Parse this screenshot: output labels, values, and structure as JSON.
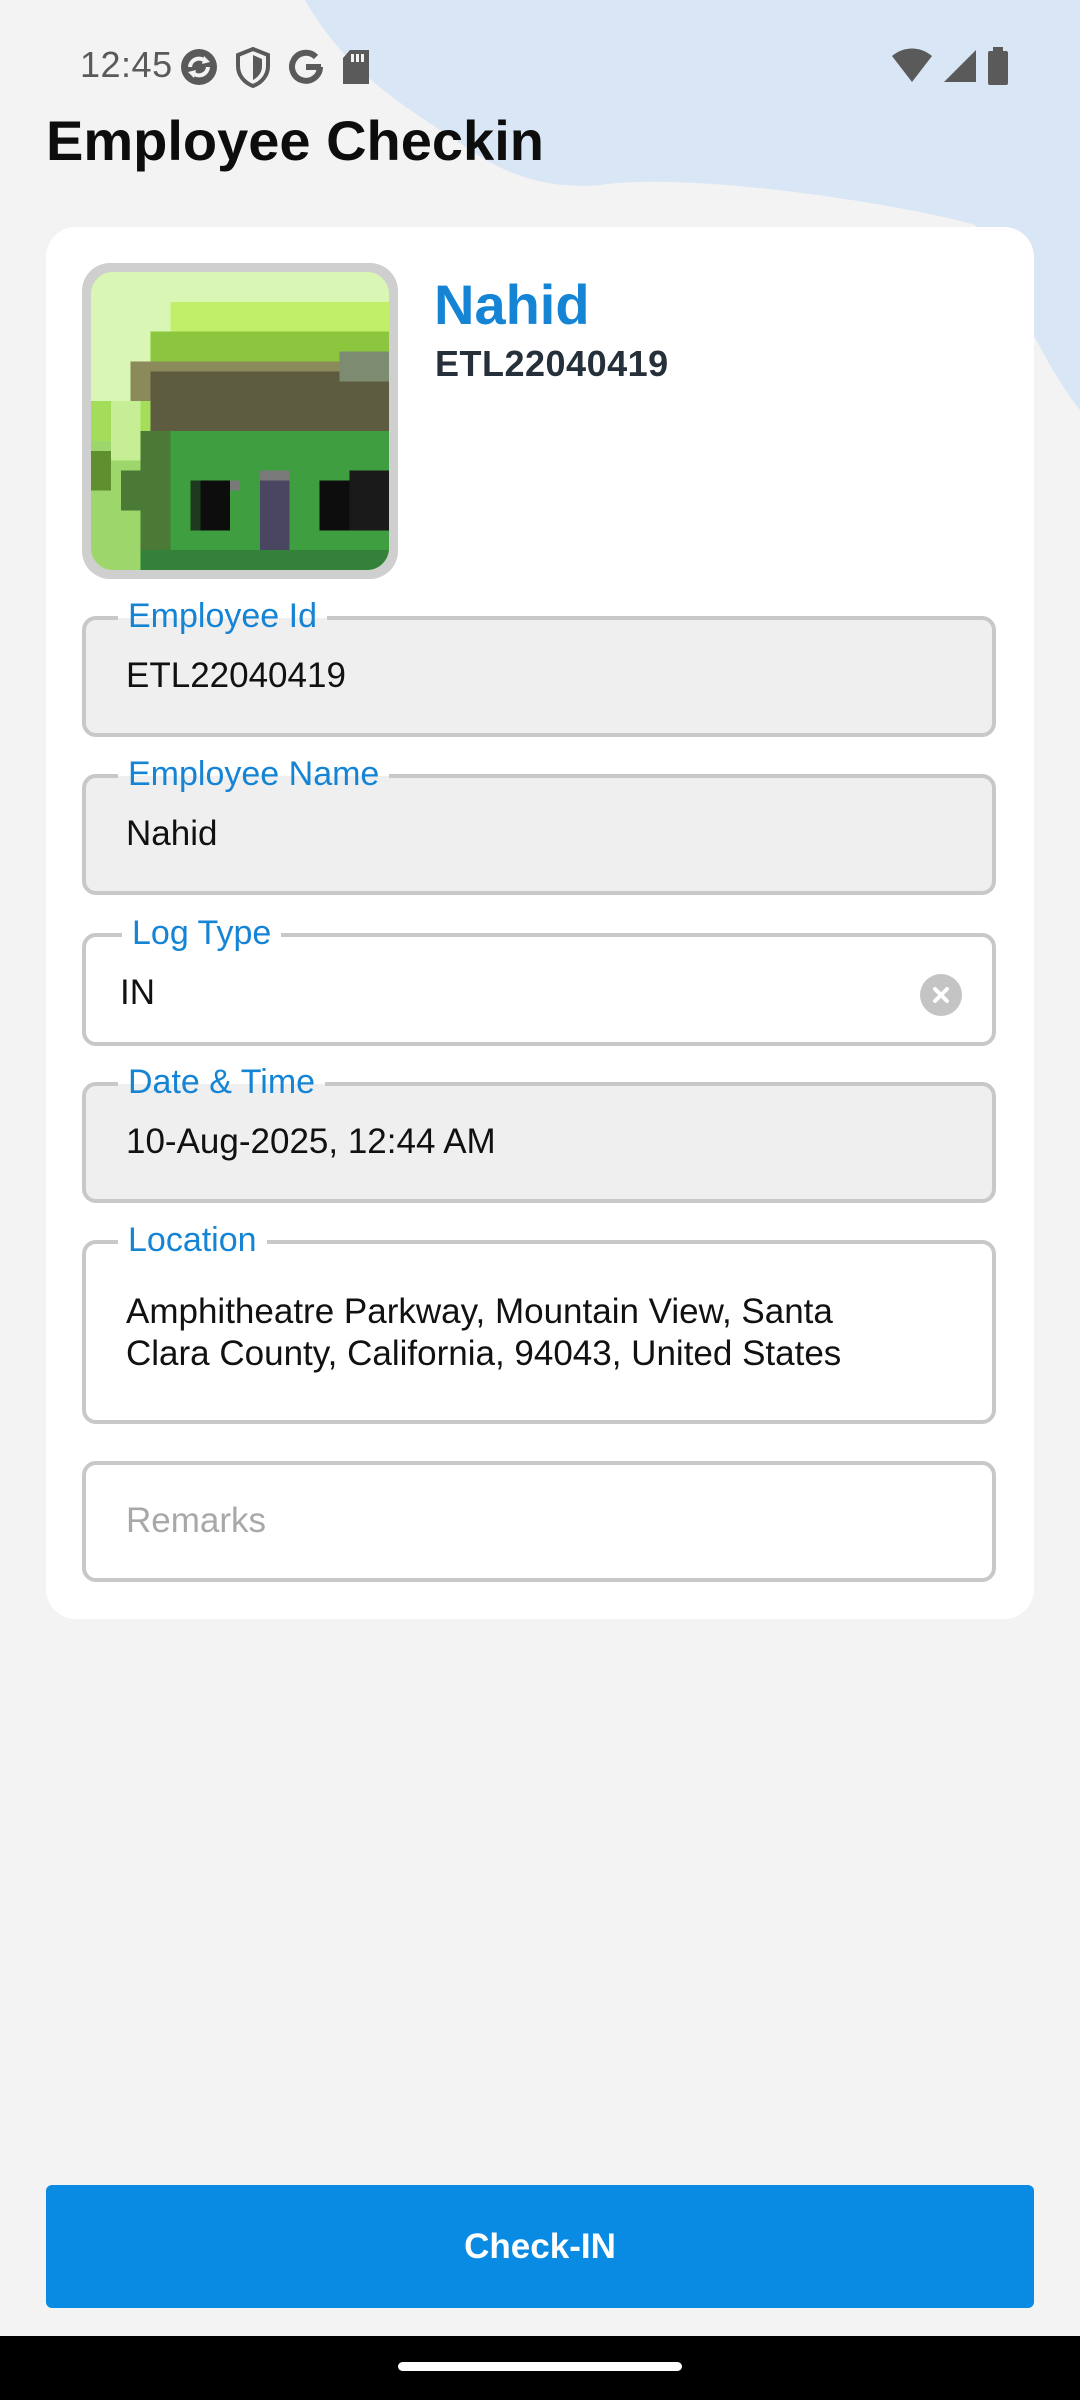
{
  "status_bar": {
    "time": "12:45",
    "left_icons": [
      "sync-icon",
      "shield-icon",
      "google-icon",
      "sd-card-icon"
    ],
    "right_icons": [
      "wifi-icon",
      "signal-icon",
      "battery-icon"
    ]
  },
  "page": {
    "title": "Employee Checkin"
  },
  "profile": {
    "name": "Nahid",
    "id": "ETL22040419",
    "avatar_icon": "house-pixel-avatar"
  },
  "form": {
    "employee_id": {
      "label": "Employee Id",
      "value": "ETL22040419"
    },
    "employee_name": {
      "label": "Employee Name",
      "value": "Nahid"
    },
    "log_type": {
      "label": "Log Type",
      "value": "IN",
      "clear_icon": "close-circle-icon"
    },
    "date_time": {
      "label": "Date & Time",
      "value": "10-Aug-2025, 12:44 AM"
    },
    "location": {
      "label": "Location",
      "line1": "Amphitheatre Parkway, Mountain View, Santa",
      "line2": "Clara County, California, 94043, United States"
    },
    "remarks": {
      "placeholder": "Remarks",
      "value": ""
    }
  },
  "actions": {
    "checkin_label": "Check-IN"
  },
  "colors": {
    "accent": "#1584d4",
    "button": "#0a8be3",
    "background": "#f3f3f3",
    "blob": "#d8e6f5"
  }
}
